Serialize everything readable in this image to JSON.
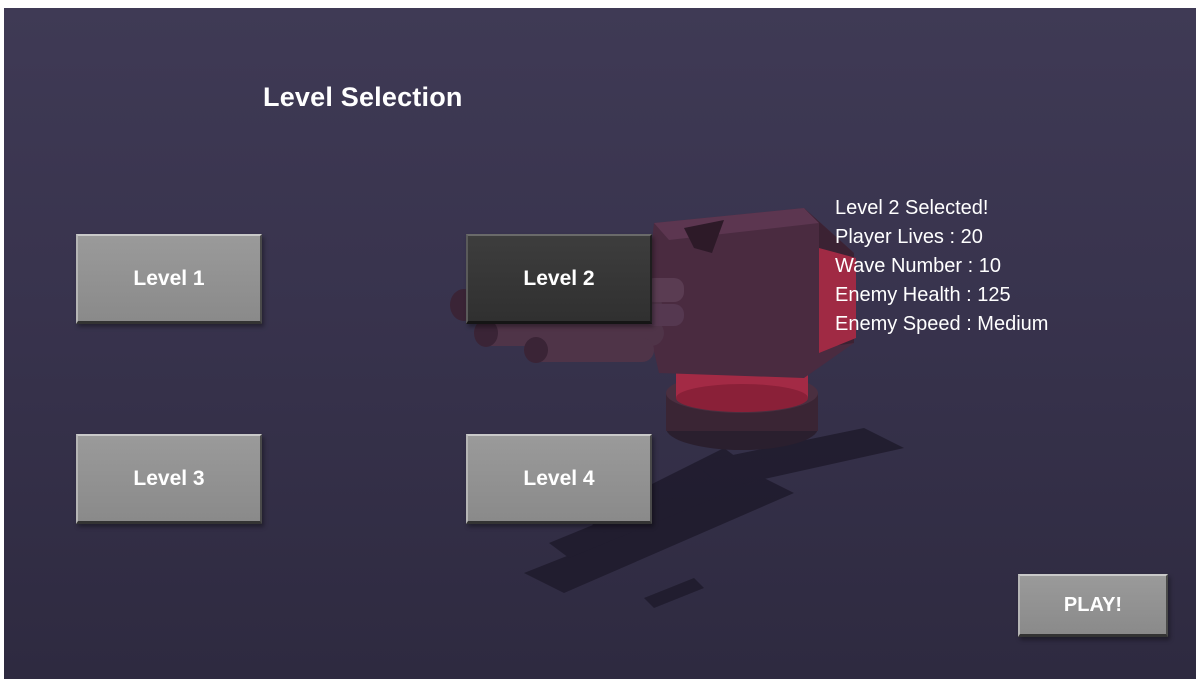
{
  "title": "Level Selection",
  "levels": [
    {
      "label": "Level 1",
      "selected": false
    },
    {
      "label": "Level 2",
      "selected": true
    },
    {
      "label": "Level 3",
      "selected": false
    },
    {
      "label": "Level 4",
      "selected": false
    }
  ],
  "info": {
    "selected_text": "Level 2 Selected!",
    "player_lives": "Player Lives : 20",
    "wave_number": "Wave Number : 10",
    "enemy_health": "Enemy Health : 125",
    "enemy_speed": "Enemy Speed : Medium"
  },
  "play_label": "PLAY!",
  "colors": {
    "background": "#38334d",
    "button": "#8f8f8f",
    "button_selected": "#353535",
    "turret_body": "#4a2a3e",
    "turret_accent": "#b0304a"
  }
}
